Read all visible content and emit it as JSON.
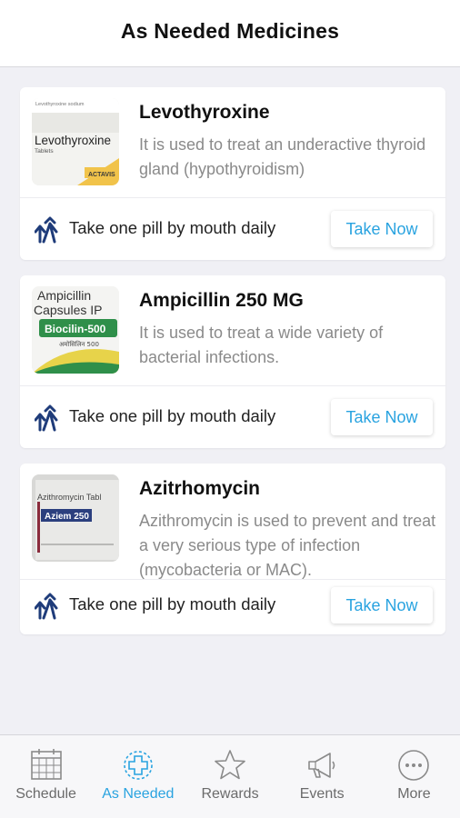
{
  "header": {
    "title": "As Needed Medicines"
  },
  "medicines": [
    {
      "name": "Levothyroxine",
      "description": "It is used to treat an underactive thyroid gland (hypothyroidism)",
      "dose": "Take one pill by mouth daily",
      "action_label": "Take Now",
      "thumb_label": "Levothyroxine",
      "thumb_sub": "Tablets",
      "thumb_top": "Levothyroxine sodium",
      "thumb_brand": "ACTAVIS"
    },
    {
      "name": "Ampicillin 250 MG",
      "description": "It is used to treat a wide variety of bacterial infections.",
      "dose": "Take one pill by mouth daily",
      "action_label": "Take Now",
      "thumb_label": "Ampicillin",
      "thumb_sub": "Capsules IP",
      "thumb_brand": "Biocilin-500",
      "thumb_extra": "अमोसिलिन 500"
    },
    {
      "name": "Azitrhomycin",
      "description": "Azithromycin is used to prevent and treat a very serious type of infection (mycobacteria or MAC).",
      "dose": "Take one pill by mouth daily",
      "action_label": "Take Now",
      "thumb_label": "Azithromycin Tabl",
      "thumb_brand": "Aziem 250"
    }
  ],
  "tabbar": {
    "tabs": [
      {
        "label": "Schedule",
        "icon": "calendar-icon",
        "active": false
      },
      {
        "label": "As Needed",
        "icon": "medical-cross-icon",
        "active": true
      },
      {
        "label": "Rewards",
        "icon": "star-icon",
        "active": false
      },
      {
        "label": "Events",
        "icon": "megaphone-icon",
        "active": false
      },
      {
        "label": "More",
        "icon": "more-dots-icon",
        "active": false
      }
    ]
  },
  "colors": {
    "accent": "#29a3e0",
    "dose_icon": "#1f3c7a",
    "background": "#f0f0f5"
  }
}
